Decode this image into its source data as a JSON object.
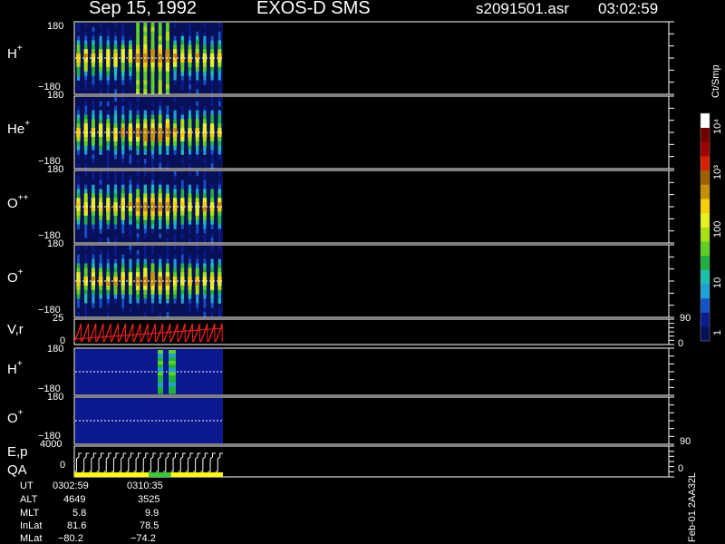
{
  "header": {
    "date": "Sep 15, 1992",
    "instrument": "EXOS-D SMS",
    "file": "s2091501.asr",
    "time": "03:02:59"
  },
  "panels": [
    {
      "species": "H",
      "charge": "+",
      "ymax": "180",
      "ymin": "−180"
    },
    {
      "species": "He",
      "charge": "+",
      "ymax": "180",
      "ymin": "−180"
    },
    {
      "species": "O",
      "charge": "++",
      "ymax": "180",
      "ymin": "−180"
    },
    {
      "species": "O",
      "charge": "+",
      "ymax": "180",
      "ymin": "−180"
    }
  ],
  "vr_panel": {
    "label": "V,r",
    "ymax": "25",
    "ymin": "0",
    "rmax": "90",
    "rmin": "0"
  },
  "low_panels": [
    {
      "species": "H",
      "charge": "+",
      "ymax": "180",
      "ymin": "−180"
    },
    {
      "species": "O",
      "charge": "+",
      "ymax": "180",
      "ymin": "−180"
    }
  ],
  "ep_panel": {
    "label": "E,p",
    "qa_label": "QA",
    "ymax": "4000",
    "ymin": "0",
    "rmax": "90",
    "rmin": "0"
  },
  "colorbar": {
    "unit": "Ct/Smp",
    "ticks": [
      "1",
      "10",
      "100",
      "10³",
      "10⁴"
    ]
  },
  "info_table": {
    "rows": [
      {
        "label": "UT",
        "v1": "0302:59",
        "v2": "0310:35"
      },
      {
        "label": "ALT",
        "v1": "4649",
        "v2": "3525"
      },
      {
        "label": "MLT",
        "v1": "5.8",
        "v2": "9.9"
      },
      {
        "label": "InLat",
        "v1": "81.6",
        "v2": "78.5"
      },
      {
        "label": "MLat",
        "v1": "−80.2",
        "v2": "−74.2"
      }
    ]
  },
  "footer": {
    "stamp": "Feb-01 2AA32L"
  },
  "chart_data": {
    "type": "heatmap",
    "title": "Sep 15, 1992    EXOS-D SMS",
    "ylim": [
      -180,
      180
    ],
    "n_spin_columns": 20,
    "colorscale": {
      "unit": "Ct/Smp",
      "log_range": [
        1,
        10000
      ]
    },
    "qa_segments": [
      {
        "from": 0.0,
        "to": 0.5,
        "color": "#ffff00"
      },
      {
        "from": 0.5,
        "to": 0.65,
        "color": "#33cc33"
      },
      {
        "from": 0.65,
        "to": 1.0,
        "color": "#ffff00"
      }
    ]
  }
}
